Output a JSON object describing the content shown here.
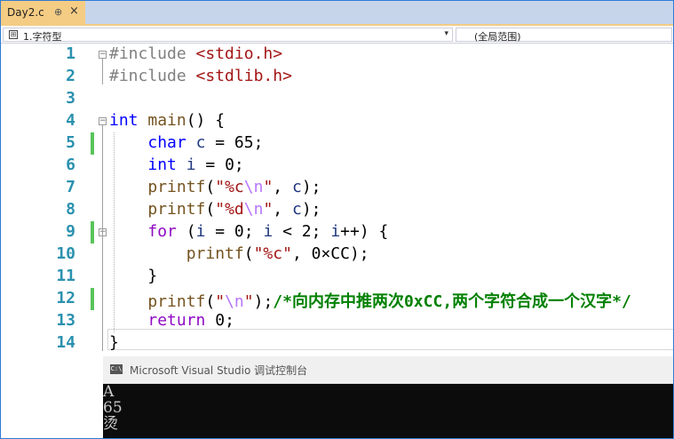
{
  "tab": {
    "title": "Day2.c",
    "pin": "⊕",
    "close": "×"
  },
  "navbar": {
    "scope": "1.字符型",
    "global_scope": "(全局范围)",
    "dropdown_arrow": "▾"
  },
  "editor": {
    "lines": [
      {
        "num": "1",
        "t": [
          {
            "s": "#include ",
            "c": "pp"
          },
          {
            "s": "<stdio.h>",
            "c": "inc"
          }
        ]
      },
      {
        "num": "2",
        "t": [
          {
            "s": "#include ",
            "c": "pp"
          },
          {
            "s": "<stdlib.h>",
            "c": "inc"
          }
        ]
      },
      {
        "num": "3",
        "t": []
      },
      {
        "num": "4",
        "t": [
          {
            "s": "int",
            "c": "ty"
          },
          {
            "s": " "
          },
          {
            "s": "main",
            "c": "fn"
          },
          {
            "s": "() {"
          }
        ]
      },
      {
        "num": "5",
        "t": [
          {
            "s": "    "
          },
          {
            "s": "char",
            "c": "ty"
          },
          {
            "s": " "
          },
          {
            "s": "c",
            "c": "var"
          },
          {
            "s": " = 65;"
          }
        ]
      },
      {
        "num": "6",
        "t": [
          {
            "s": "    "
          },
          {
            "s": "int",
            "c": "ty"
          },
          {
            "s": " "
          },
          {
            "s": "i",
            "c": "var"
          },
          {
            "s": " = 0;"
          }
        ]
      },
      {
        "num": "7",
        "t": [
          {
            "s": "    "
          },
          {
            "s": "printf",
            "c": "fn"
          },
          {
            "s": "("
          },
          {
            "s": "\"%c",
            "c": "str"
          },
          {
            "s": "\\n",
            "c": "esc"
          },
          {
            "s": "\"",
            "c": "str"
          },
          {
            "s": ", "
          },
          {
            "s": "c",
            "c": "var"
          },
          {
            "s": ");"
          }
        ]
      },
      {
        "num": "8",
        "t": [
          {
            "s": "    "
          },
          {
            "s": "printf",
            "c": "fn"
          },
          {
            "s": "("
          },
          {
            "s": "\"%d",
            "c": "str"
          },
          {
            "s": "\\n",
            "c": "esc"
          },
          {
            "s": "\"",
            "c": "str"
          },
          {
            "s": ", "
          },
          {
            "s": "c",
            "c": "var"
          },
          {
            "s": ");"
          }
        ]
      },
      {
        "num": "9",
        "t": [
          {
            "s": "    "
          },
          {
            "s": "for",
            "c": "ctl"
          },
          {
            "s": " ("
          },
          {
            "s": "i",
            "c": "var"
          },
          {
            "s": " = 0; "
          },
          {
            "s": "i",
            "c": "var"
          },
          {
            "s": " < 2; "
          },
          {
            "s": "i",
            "c": "var"
          },
          {
            "s": "++) {"
          }
        ]
      },
      {
        "num": "10",
        "t": [
          {
            "s": "        "
          },
          {
            "s": "printf",
            "c": "fn"
          },
          {
            "s": "("
          },
          {
            "s": "\"%c\"",
            "c": "str"
          },
          {
            "s": ", 0×CC);"
          }
        ]
      },
      {
        "num": "11",
        "t": [
          {
            "s": "    }"
          }
        ]
      },
      {
        "num": "12",
        "t": [
          {
            "s": "    "
          },
          {
            "s": "printf",
            "c": "fn"
          },
          {
            "s": "("
          },
          {
            "s": "\"",
            "c": "str"
          },
          {
            "s": "\\n",
            "c": "esc"
          },
          {
            "s": "\"",
            "c": "str"
          },
          {
            "s": ");"
          },
          {
            "s": "/*向内存中推两次0xCC,两个字符合成一个汉字*/",
            "c": "cmt"
          }
        ]
      },
      {
        "num": "13",
        "t": [
          {
            "s": "    "
          },
          {
            "s": "return",
            "c": "ctl"
          },
          {
            "s": " 0;"
          }
        ]
      },
      {
        "num": "14",
        "t": [
          {
            "s": "}"
          }
        ]
      }
    ]
  },
  "console": {
    "title": "Microsoft Visual Studio 调试控制台",
    "icon_label": "C:\\",
    "output": "A\n65\n烫"
  }
}
